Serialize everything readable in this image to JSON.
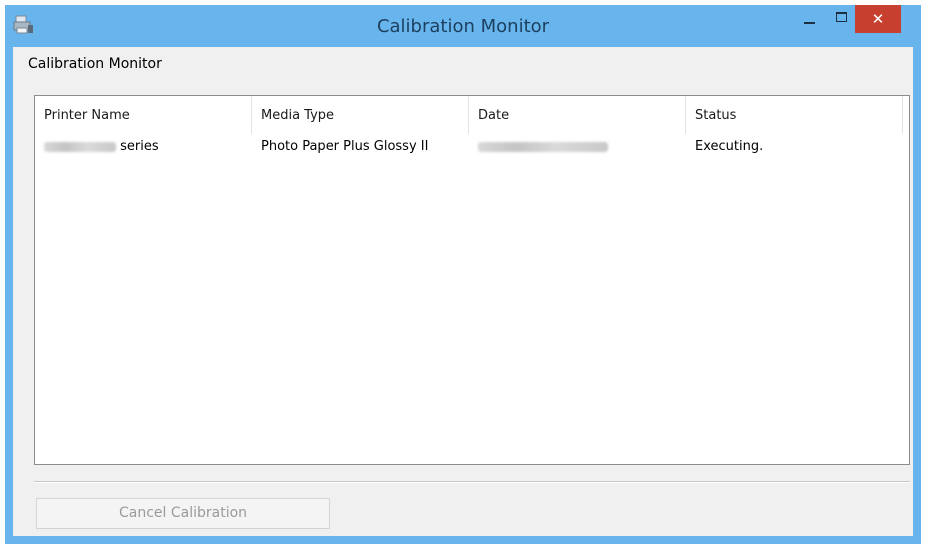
{
  "window": {
    "title": "Calibration Monitor",
    "close_glyph": "✕",
    "app_icon": "printer-icon",
    "accent_color": "#68b4ec",
    "close_color": "#c7402f"
  },
  "section": {
    "label": "Calibration Monitor"
  },
  "table": {
    "columns": [
      "Printer Name",
      "Media Type",
      "Date",
      "Status"
    ],
    "rows": [
      {
        "printer_name_suffix": "series",
        "media_type": "Photo Paper Plus Glossy II",
        "status": "Executing."
      }
    ]
  },
  "actions": {
    "cancel_label": "Cancel Calibration"
  }
}
